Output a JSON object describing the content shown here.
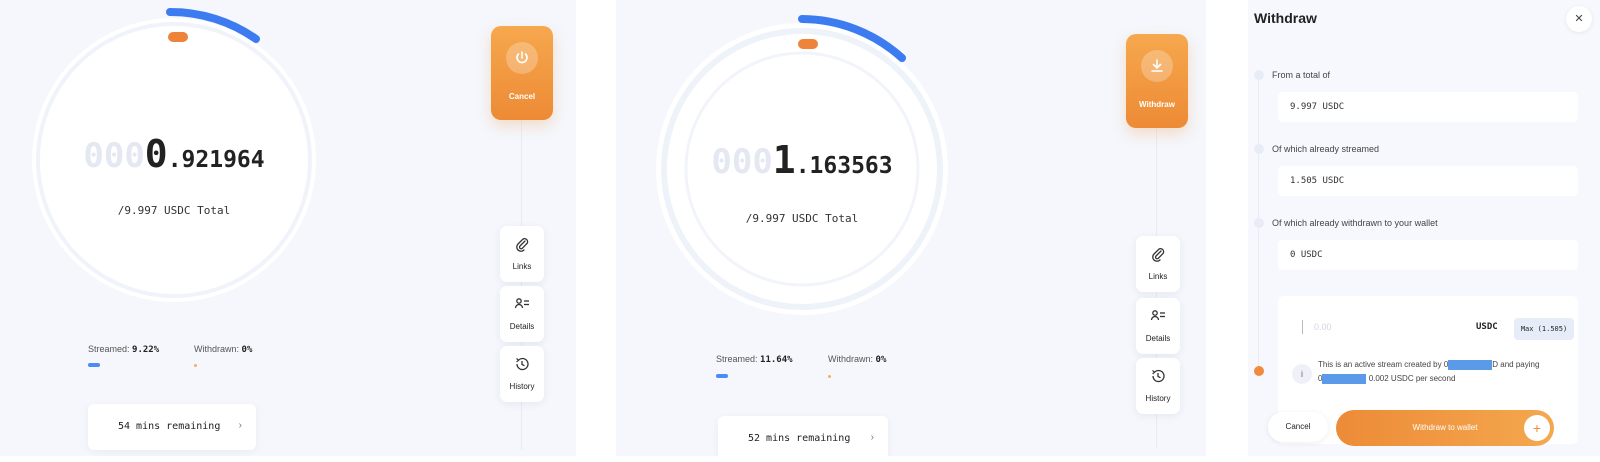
{
  "colors": {
    "accent_orange": "#ed8a35",
    "progress_blue": "#3d7bf0",
    "panel_bg": "#f5f7fc"
  },
  "streams": [
    {
      "counter_leading": "000",
      "counter_whole": "0",
      "counter_decimal": ".921964",
      "total_text": "/9.997 USDC Total",
      "action_label": "Cancel",
      "action_icon": "power-icon",
      "links_label": "Links",
      "details_label": "Details",
      "history_label": "History",
      "streamed_label": "Streamed:",
      "streamed_value": "9.22%",
      "withdrawn_label": "Withdrawn:",
      "withdrawn_value": "0%",
      "remaining_text": "54 mins remaining",
      "remaining_chevron": "›"
    },
    {
      "counter_leading": "000",
      "counter_whole": "1",
      "counter_decimal": ".163563",
      "total_text": "/9.997 USDC Total",
      "action_label": "Withdraw",
      "action_icon": "download-icon",
      "links_label": "Links",
      "details_label": "Details",
      "history_label": "History",
      "streamed_label": "Streamed:",
      "streamed_value": "11.64%",
      "withdrawn_label": "Withdrawn:",
      "withdrawn_value": "0%",
      "remaining_text": "52 mins remaining",
      "remaining_chevron": "›"
    }
  ],
  "withdraw": {
    "title": "Withdraw",
    "close": "✕",
    "total_label": "From a total of",
    "total_value": "9.997 USDC",
    "streamed_label": "Of which already streamed",
    "streamed_value": "1.505 USDC",
    "withdrawn_label": "Of which already withdrawn to your wallet",
    "withdrawn_value": "0 USDC",
    "amount_placeholder": "0.00",
    "currency": "USDC",
    "max_label": "Max (1.505)",
    "info_icon": "i",
    "info_part1": "This is an active stream created by 0",
    "info_part2": "D and paying",
    "info_part3": "0",
    "info_part4": "0.002 USDC per second",
    "cancel_label": "Cancel",
    "submit_label": "Withdraw to wallet",
    "submit_icon": "+"
  }
}
